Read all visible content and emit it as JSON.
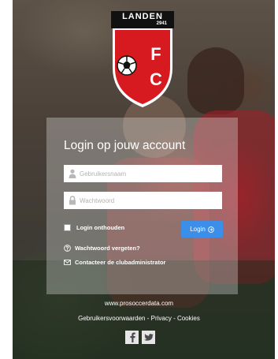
{
  "logo": {
    "name": "LANDEN",
    "year": "2941",
    "letter_left": "F",
    "letter_right": "C"
  },
  "login": {
    "title": "Login op jouw account",
    "username_placeholder": "Gebruikersnaam",
    "password_placeholder": "Wachtwoord",
    "remember_label": "Login onthouden",
    "login_button": "Login",
    "forgot_password": "Wachtwoord vergeten?",
    "contact_admin": "Contacteer de clubadministrator"
  },
  "footer": {
    "site": "www.prosoccerdata.com",
    "terms": "Gebruikersvoorwaarden",
    "separator1": " - ",
    "privacy": "Privacy",
    "separator2": " - ",
    "cookies": "Cookies"
  },
  "colors": {
    "accent": "#3c8fe8",
    "club_red": "#d71920"
  },
  "icons": [
    "user-icon",
    "lock-icon",
    "arrow-circle-right-icon",
    "question-circle-icon",
    "envelope-icon",
    "facebook-icon",
    "twitter-icon"
  ]
}
